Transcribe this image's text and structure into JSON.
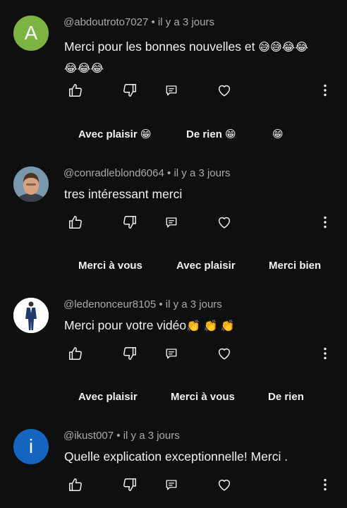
{
  "comments": [
    {
      "avatar_letter": "A",
      "avatar_color": "#7cb342",
      "author": "@abdoutroto7027",
      "time": "il y a 3 jours",
      "text_line1": "Merci pour les bonnes nouvelles et ",
      "emoji_line1": "😅😅😂😂",
      "emoji_line2": "😂😂😂",
      "suggested_replies": [
        "Avec plaisir 😁",
        "De rien 😁",
        "😁"
      ]
    },
    {
      "author": "@conradleblond6064",
      "time": "il y a 3 jours",
      "text": "tres intéressant merci",
      "suggested_replies": [
        "Merci à vous",
        "Avec plaisir",
        "Merci bien"
      ]
    },
    {
      "author": "@ledenonceur8105",
      "time": "il y a 3 jours",
      "text": "Merci pour votre vidéo",
      "emoji": "👏 👏 👏",
      "suggested_replies": [
        "Avec plaisir",
        "Merci à vous",
        "De rien"
      ]
    },
    {
      "avatar_letter": "i",
      "avatar_color": "#1565c0",
      "author": "@ikust007",
      "time": "il y a 3 jours",
      "text": "Quelle explication exceptionnelle! Merci ."
    }
  ],
  "meta_separator": " • ",
  "icons": [
    "like-icon",
    "dislike-icon",
    "reply-icon",
    "heart-icon",
    "more-options-icon"
  ],
  "colors": {
    "background": "#0f0f0f",
    "text": "#f1f1f1",
    "secondary_text": "#aaaaaa"
  }
}
